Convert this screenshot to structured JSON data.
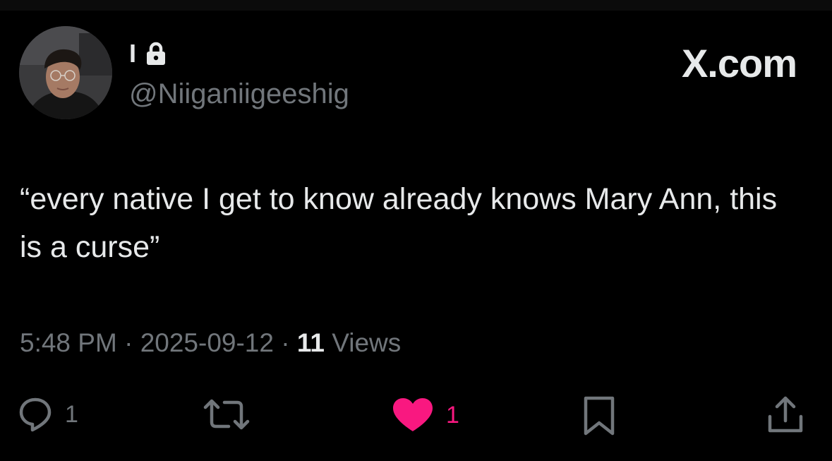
{
  "author": {
    "display_name": "I",
    "handle": "@Niiganiigeeshig"
  },
  "brand": "X.com",
  "tweet": {
    "text": "“every native I get to know already knows Mary Ann, this is a curse”"
  },
  "meta": {
    "time": "5:48 PM",
    "separator": " · ",
    "date": "2025-09-12",
    "views_count": "11",
    "views_label": " Views"
  },
  "actions": {
    "reply_count": "1",
    "like_count": "1"
  },
  "colors": {
    "background": "#000000",
    "text": "#e7e9ea",
    "muted": "#71767b",
    "like": "#f91880"
  },
  "icons": [
    "lock-icon",
    "reply-icon",
    "retweet-icon",
    "heart-icon",
    "bookmark-icon",
    "share-icon"
  ]
}
